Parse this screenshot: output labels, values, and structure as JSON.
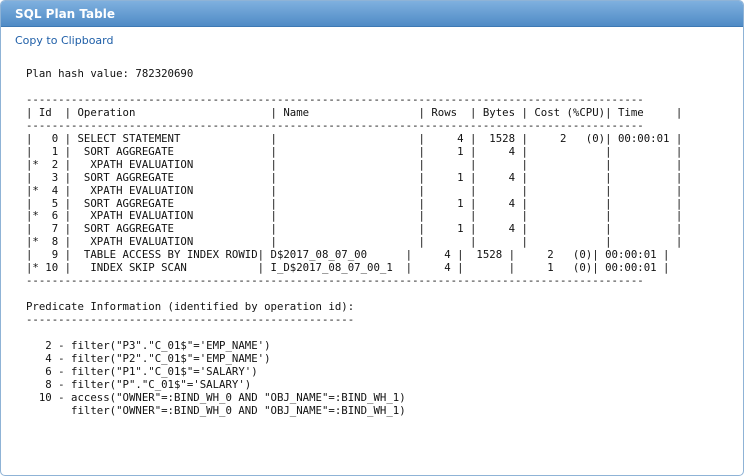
{
  "window": {
    "title": "SQL Plan Table"
  },
  "actions": {
    "copy_label": "Copy to Clipboard"
  },
  "plan": {
    "text": "Plan hash value: 782320690\n\n------------------------------------------------------------------------------------------------\n| Id  | Operation                     | Name                 | Rows  | Bytes | Cost (%CPU)| Time     |\n------------------------------------------------------------------------------------------------\n|   0 | SELECT STATEMENT              |                      |     4 |  1528 |     2   (0)| 00:00:01 |\n|   1 |  SORT AGGREGATE               |                      |     1 |     4 |            |          |\n|*  2 |   XPATH EVALUATION            |                      |       |       |            |          |\n|   3 |  SORT AGGREGATE               |                      |     1 |     4 |            |          |\n|*  4 |   XPATH EVALUATION            |                      |       |       |            |          |\n|   5 |  SORT AGGREGATE               |                      |     1 |     4 |            |          |\n|*  6 |   XPATH EVALUATION            |                      |       |       |            |          |\n|   7 |  SORT AGGREGATE               |                      |     1 |     4 |            |          |\n|*  8 |   XPATH EVALUATION            |                      |       |       |            |          |\n|   9 |  TABLE ACCESS BY INDEX ROWID| D$2017_08_07_00      |     4 |  1528 |     2   (0)| 00:00:01 |\n|* 10 |   INDEX SKIP SCAN           | I_D$2017_08_07_00_1  |     4 |       |     1   (0)| 00:00:01 |\n------------------------------------------------------------------------------------------------\n\nPredicate Information (identified by operation id):\n---------------------------------------------------\n\n   2 - filter(\"P3\".\"C_01$\"='EMP_NAME')\n   4 - filter(\"P2\".\"C_01$\"='EMP_NAME')\n   6 - filter(\"P1\".\"C_01$\"='SALARY')\n   8 - filter(\"P\".\"C_01$\"='SALARY')\n  10 - access(\"OWNER\"=:BIND_WH_0 AND \"OBJ_NAME\"=:BIND_WH_1)\n       filter(\"OWNER\"=:BIND_WH_0 AND \"OBJ_NAME\"=:BIND_WH_1)"
  },
  "colors": {
    "title_bar_top": "#7fb0df",
    "title_bar_bottom": "#4f8bc6",
    "link": "#1f5fa8",
    "border": "#8fb3d6"
  }
}
